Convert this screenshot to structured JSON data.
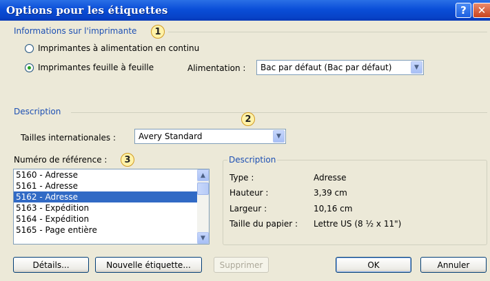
{
  "window": {
    "title": "Options pour les étiquettes",
    "help_glyph": "?",
    "close_glyph": "✕"
  },
  "printer": {
    "group_title": "Informations sur l'imprimante",
    "callout": "1",
    "radio_continuous": "Imprimantes à alimentation en continu",
    "radio_sheet": "Imprimantes feuille à feuille",
    "selected": "sheet",
    "feed_label": "Alimentation :",
    "feed_value": "Bac par défaut (Bac par défaut)"
  },
  "description_group": {
    "group_title": "Description",
    "callout": "2",
    "sizes_label": "Tailles internationales :",
    "sizes_value": "Avery Standard"
  },
  "reference": {
    "label": "Numéro de référence :",
    "callout": "3",
    "items": [
      "5160 - Adresse",
      "5161 - Adresse",
      "5162 - Adresse",
      "5163 - Expédition",
      "5164 - Expédition",
      "5165 - Page entière"
    ],
    "selected_index": 2
  },
  "details_panel": {
    "title": "Description",
    "rows": [
      {
        "label": "Type :",
        "value": "Adresse"
      },
      {
        "label": "Hauteur :",
        "value": "3,39 cm"
      },
      {
        "label": "Largeur :",
        "value": "10,16 cm"
      },
      {
        "label": "Taille du papier :",
        "value": "Lettre US (8 ½ x 11\")"
      }
    ]
  },
  "buttons": {
    "details": "Détails...",
    "new_label": "Nouvelle étiquette...",
    "delete": "Supprimer",
    "ok": "OK",
    "cancel": "Annuler"
  },
  "colors": {
    "title_bar": "#0a4ed8",
    "group_title": "#1c4fb3",
    "selection": "#316ac5",
    "callout_fill": "#fff2a8"
  }
}
